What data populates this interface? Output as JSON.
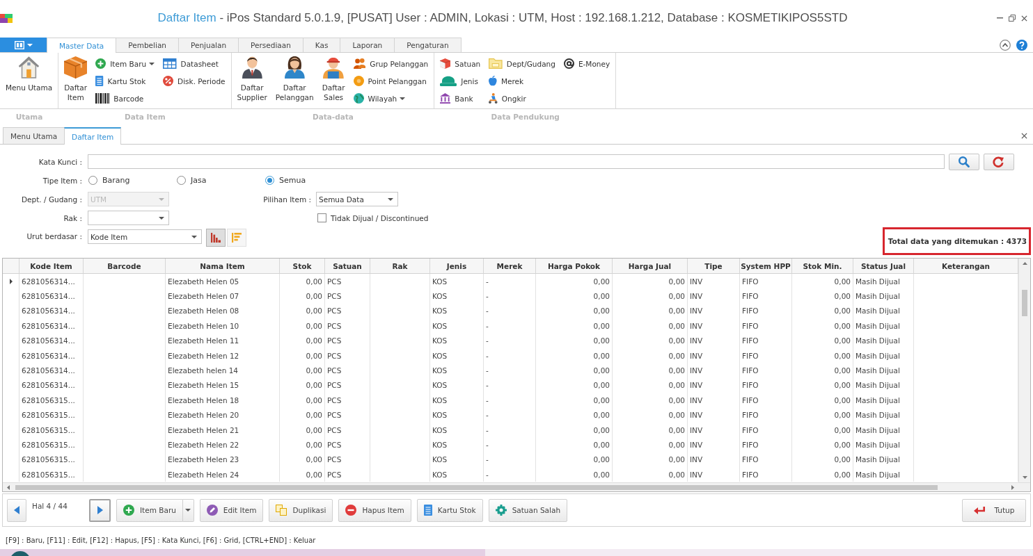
{
  "window": {
    "title": {
      "document": "Daftar Item",
      "details": "- iPos Standard 5.0.1.9, [PUSAT] User : ADMIN, Lokasi : UTM, Host : 192.168.1.212, Database : KOSMETIKIPOS5STD"
    }
  },
  "ribbon": {
    "tabs": [
      {
        "label": "Master Data",
        "selected": true
      },
      {
        "label": "Pembelian",
        "selected": false
      },
      {
        "label": "Penjualan",
        "selected": false
      },
      {
        "label": "Persediaan",
        "selected": false
      },
      {
        "label": "Kas",
        "selected": false
      },
      {
        "label": "Laporan",
        "selected": false
      },
      {
        "label": "Pengaturan",
        "selected": false
      }
    ],
    "groups": [
      {
        "label": "Utama",
        "items": [
          {
            "kind": "large",
            "label": "Menu Utama",
            "dropdown": false
          }
        ]
      },
      {
        "label": "Data Item",
        "items": [
          {
            "kind": "large",
            "label": "Daftar Item",
            "dropdown": false
          },
          {
            "kind": "small",
            "label": "Item Baru",
            "dropdown": true
          },
          {
            "kind": "small",
            "label": "Kartu Stok",
            "dropdown": false
          },
          {
            "kind": "small",
            "label": "Barcode",
            "dropdown": false
          },
          {
            "kind": "small",
            "label": "Datasheet",
            "dropdown": false
          },
          {
            "kind": "small",
            "label": "Disk. Periode",
            "dropdown": false
          }
        ]
      },
      {
        "label": "Data-data",
        "items": [
          {
            "kind": "large",
            "label": "Daftar Supplier",
            "dropdown": false
          },
          {
            "kind": "large",
            "label": "Daftar Pelanggan",
            "dropdown": false
          },
          {
            "kind": "large",
            "label": "Daftar Sales",
            "dropdown": false
          },
          {
            "kind": "small",
            "label": "Grup Pelanggan",
            "dropdown": false
          },
          {
            "kind": "small",
            "label": "Point Pelanggan",
            "dropdown": false
          },
          {
            "kind": "small",
            "label": "Wilayah",
            "dropdown": true
          }
        ]
      },
      {
        "label": "Data Pendukung",
        "items": [
          {
            "kind": "small",
            "label": "Satuan",
            "dropdown": false
          },
          {
            "kind": "small",
            "label": "Jenis",
            "dropdown": false
          },
          {
            "kind": "small",
            "label": "Bank",
            "dropdown": false
          },
          {
            "kind": "small",
            "label": "Dept/Gudang",
            "dropdown": false
          },
          {
            "kind": "small",
            "label": "Merek",
            "dropdown": false
          },
          {
            "kind": "small",
            "label": "Ongkir",
            "dropdown": false
          },
          {
            "kind": "small",
            "label": "E-Money",
            "dropdown": false
          }
        ]
      }
    ]
  },
  "document_tabs": [
    {
      "label": "Menu Utama",
      "selected": false
    },
    {
      "label": "Daftar Item",
      "selected": true
    }
  ],
  "search_form": {
    "keyword": {
      "label": "Kata Kunci :"
    },
    "item_type": {
      "label": "Tipe Item :",
      "options": [
        {
          "label": "Barang",
          "selected": false
        },
        {
          "label": "Jasa",
          "selected": false
        },
        {
          "label": "Semua",
          "selected": true
        }
      ]
    },
    "department": {
      "label": "Dept. / Gudang :",
      "value": "UTM",
      "disabled": true
    },
    "item_choice": {
      "label": "Pilihan Item :",
      "value": "Semua Data",
      "disabled": false
    },
    "rack": {
      "label": "Rak :",
      "disabled": false
    },
    "discontinued": {
      "label": "Tidak Dijual / Discontinued",
      "checked": false
    },
    "sort": {
      "label": "Urut berdasar :",
      "value": "Kode Item",
      "disabled": false,
      "directions": [
        {
          "selected": true
        },
        {
          "selected": false
        }
      ]
    },
    "total": "Total data yang ditemukan : 4373"
  },
  "table": {
    "columns": [
      {
        "label": "Kode Item",
        "kind": "text"
      },
      {
        "label": "Barcode",
        "kind": "text"
      },
      {
        "label": "Nama Item",
        "kind": "text"
      },
      {
        "label": "Stok",
        "kind": "number"
      },
      {
        "label": "Satuan",
        "kind": "text"
      },
      {
        "label": "Rak",
        "kind": "text"
      },
      {
        "label": "Jenis",
        "kind": "text"
      },
      {
        "label": "Merek",
        "kind": "text"
      },
      {
        "label": "Harga Pokok",
        "kind": "number"
      },
      {
        "label": "Harga Jual",
        "kind": "number"
      },
      {
        "label": "Tipe",
        "kind": "text"
      },
      {
        "label": "System HPP",
        "kind": "text"
      },
      {
        "label": "Stok Min.",
        "kind": "number"
      },
      {
        "label": "Status Jual",
        "kind": "text"
      },
      {
        "label": "Keterangan",
        "kind": "text"
      }
    ],
    "rows": [
      {
        "selected": true,
        "kode_item": "6281056314...",
        "nama_item": "Elezabeth Helen 05",
        "stok": "0,00",
        "satuan": "PCS",
        "jenis": "KOS",
        "merek": "-",
        "harga_pokok": "0,00",
        "harga_jual": "0,00",
        "tipe": "INV",
        "system_hpp": "FIFO",
        "stok_min": "0,00",
        "status_jual": "Masih Dijual"
      },
      {
        "selected": false,
        "kode_item": "6281056314...",
        "nama_item": "Elezabeth Helen 07",
        "stok": "0,00",
        "satuan": "PCS",
        "jenis": "KOS",
        "merek": "-",
        "harga_pokok": "0,00",
        "harga_jual": "0,00",
        "tipe": "INV",
        "system_hpp": "FIFO",
        "stok_min": "0,00",
        "status_jual": "Masih Dijual"
      },
      {
        "selected": false,
        "kode_item": "6281056314...",
        "nama_item": "Elezabeth Helen 08",
        "stok": "0,00",
        "satuan": "PCS",
        "jenis": "KOS",
        "merek": "-",
        "harga_pokok": "0,00",
        "harga_jual": "0,00",
        "tipe": "INV",
        "system_hpp": "FIFO",
        "stok_min": "0,00",
        "status_jual": "Masih Dijual"
      },
      {
        "selected": false,
        "kode_item": "6281056314...",
        "nama_item": "Elezabeth Helen 10",
        "stok": "0,00",
        "satuan": "PCS",
        "jenis": "KOS",
        "merek": "-",
        "harga_pokok": "0,00",
        "harga_jual": "0,00",
        "tipe": "INV",
        "system_hpp": "FIFO",
        "stok_min": "0,00",
        "status_jual": "Masih Dijual"
      },
      {
        "selected": false,
        "kode_item": "6281056314...",
        "nama_item": "Elezabeth Helen 11",
        "stok": "0,00",
        "satuan": "PCS",
        "jenis": "KOS",
        "merek": "-",
        "harga_pokok": "0,00",
        "harga_jual": "0,00",
        "tipe": "INV",
        "system_hpp": "FIFO",
        "stok_min": "0,00",
        "status_jual": "Masih Dijual"
      },
      {
        "selected": false,
        "kode_item": "6281056314...",
        "nama_item": "Elezabeth Helen 12",
        "stok": "0,00",
        "satuan": "PCS",
        "jenis": "KOS",
        "merek": "-",
        "harga_pokok": "0,00",
        "harga_jual": "0,00",
        "tipe": "INV",
        "system_hpp": "FIFO",
        "stok_min": "0,00",
        "status_jual": "Masih Dijual"
      },
      {
        "selected": false,
        "kode_item": "6281056314...",
        "nama_item": "Elezabeth helen 14",
        "stok": "0,00",
        "satuan": "PCS",
        "jenis": "KOS",
        "merek": "-",
        "harga_pokok": "0,00",
        "harga_jual": "0,00",
        "tipe": "INV",
        "system_hpp": "FIFO",
        "stok_min": "0,00",
        "status_jual": "Masih Dijual"
      },
      {
        "selected": false,
        "kode_item": "6281056314...",
        "nama_item": "Elezabeth Helen 15",
        "stok": "0,00",
        "satuan": "PCS",
        "jenis": "KOS",
        "merek": "-",
        "harga_pokok": "0,00",
        "harga_jual": "0,00",
        "tipe": "INV",
        "system_hpp": "FIFO",
        "stok_min": "0,00",
        "status_jual": "Masih Dijual"
      },
      {
        "selected": false,
        "kode_item": "6281056315...",
        "nama_item": "Elezabeth Helen 18",
        "stok": "0,00",
        "satuan": "PCS",
        "jenis": "KOS",
        "merek": "-",
        "harga_pokok": "0,00",
        "harga_jual": "0,00",
        "tipe": "INV",
        "system_hpp": "FIFO",
        "stok_min": "0,00",
        "status_jual": "Masih Dijual"
      },
      {
        "selected": false,
        "kode_item": "6281056315...",
        "nama_item": "Elezabeth Helen 20",
        "stok": "0,00",
        "satuan": "PCS",
        "jenis": "KOS",
        "merek": "-",
        "harga_pokok": "0,00",
        "harga_jual": "0,00",
        "tipe": "INV",
        "system_hpp": "FIFO",
        "stok_min": "0,00",
        "status_jual": "Masih Dijual"
      },
      {
        "selected": false,
        "kode_item": "6281056315...",
        "nama_item": "Elezabeth Helen 21",
        "stok": "0,00",
        "satuan": "PCS",
        "jenis": "KOS",
        "merek": "-",
        "harga_pokok": "0,00",
        "harga_jual": "0,00",
        "tipe": "INV",
        "system_hpp": "FIFO",
        "stok_min": "0,00",
        "status_jual": "Masih Dijual"
      },
      {
        "selected": false,
        "kode_item": "6281056315...",
        "nama_item": "Elezabeth Helen 22",
        "stok": "0,00",
        "satuan": "PCS",
        "jenis": "KOS",
        "merek": "-",
        "harga_pokok": "0,00",
        "harga_jual": "0,00",
        "tipe": "INV",
        "system_hpp": "FIFO",
        "stok_min": "0,00",
        "status_jual": "Masih Dijual"
      },
      {
        "selected": false,
        "kode_item": "6281056315...",
        "nama_item": "Elezabeth Helen 23",
        "stok": "0,00",
        "satuan": "PCS",
        "jenis": "KOS",
        "merek": "-",
        "harga_pokok": "0,00",
        "harga_jual": "0,00",
        "tipe": "INV",
        "system_hpp": "FIFO",
        "stok_min": "0,00",
        "status_jual": "Masih Dijual"
      },
      {
        "selected": false,
        "kode_item": "6281056315...",
        "nama_item": "Elezabeth Helen 24",
        "stok": "0,00",
        "satuan": "PCS",
        "jenis": "KOS",
        "merek": "-",
        "harga_pokok": "0,00",
        "harga_jual": "0,00",
        "tipe": "INV",
        "system_hpp": "FIFO",
        "stok_min": "0,00",
        "status_jual": "Masih Dijual"
      }
    ]
  },
  "toolbar": {
    "pager": {
      "label": "Hal 4 / 44",
      "previous": {
        "focused": false
      },
      "next": {
        "focused": true
      }
    },
    "buttons": [
      {
        "label": "Item Baru",
        "dropdown": true
      },
      {
        "label": "Edit Item",
        "dropdown": false
      },
      {
        "label": "Duplikasi",
        "dropdown": false
      },
      {
        "label": "Hapus Item",
        "dropdown": false
      },
      {
        "label": "Kartu Stok",
        "dropdown": false
      },
      {
        "label": "Satuan Salah",
        "dropdown": false
      }
    ],
    "close_button": {
      "label": "Tutup"
    }
  },
  "status_bar": {
    "text": "[F9] : Baru, [F11] : Edit, [F12] : Hapus, [F5] : Kata Kunci, [F6] : Grid, [CTRL+END] : Keluar"
  }
}
